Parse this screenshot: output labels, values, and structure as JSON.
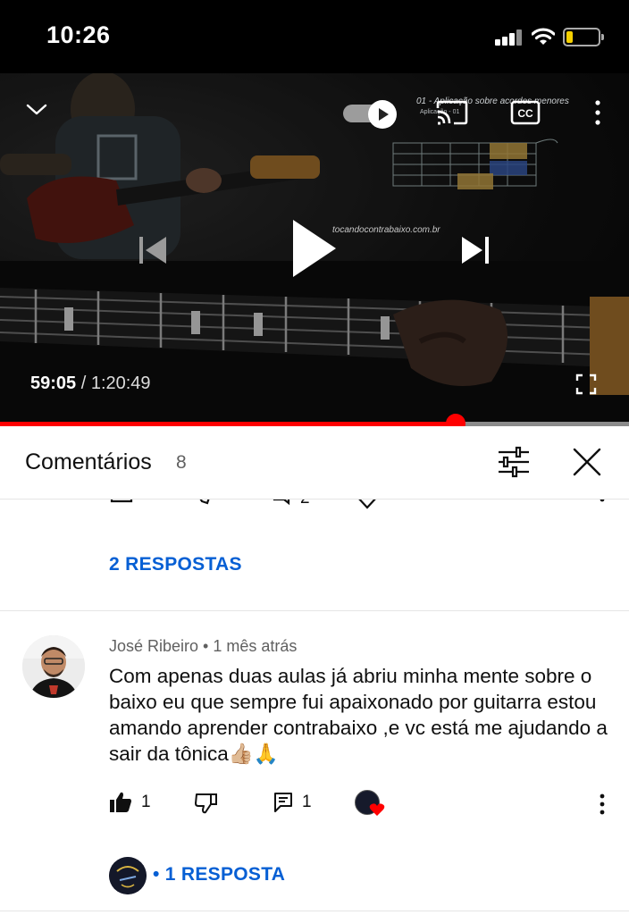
{
  "status_bar": {
    "time": "10:26"
  },
  "player": {
    "current_time": "59:05",
    "separator": " / ",
    "total_time": "1:20:49",
    "progress": 0.725,
    "overlay_title": "01 - Aplicação sobre acordes menores",
    "overlay_subtitle": "Aplicação - 01",
    "overlay_watermark": "tocandocontrabaixo.com.br",
    "icons": [
      "chevron-down-icon",
      "autoplay-toggle",
      "cast-icon",
      "cc-icon",
      "more-vertical-icon",
      "previous-icon",
      "play-icon",
      "next-icon",
      "fullscreen-icon"
    ]
  },
  "comments_header": {
    "title": "Comentários",
    "count": "8"
  },
  "comments": {
    "first_replies_label": "2 RESPOSTAS",
    "partial_action_counts": {
      "replies": "2"
    },
    "second": {
      "author": "José Ribeiro",
      "bullet": " • ",
      "time": "1 mês atrás",
      "text": "Com apenas duas aulas já abriu minha mente sobre o baixo eu que sempre fui apaixonado por guitarra estou amando aprender contrabaixo ,e vc está me ajudando a sair da tônica👍🏼🙏",
      "likes": "1",
      "replies": "1",
      "replies_label": "• 1 RESPOSTA"
    }
  },
  "colors": {
    "accent_blue": "#065fd4",
    "progress_red": "#ff0000",
    "heart_red": "#ff0000"
  }
}
